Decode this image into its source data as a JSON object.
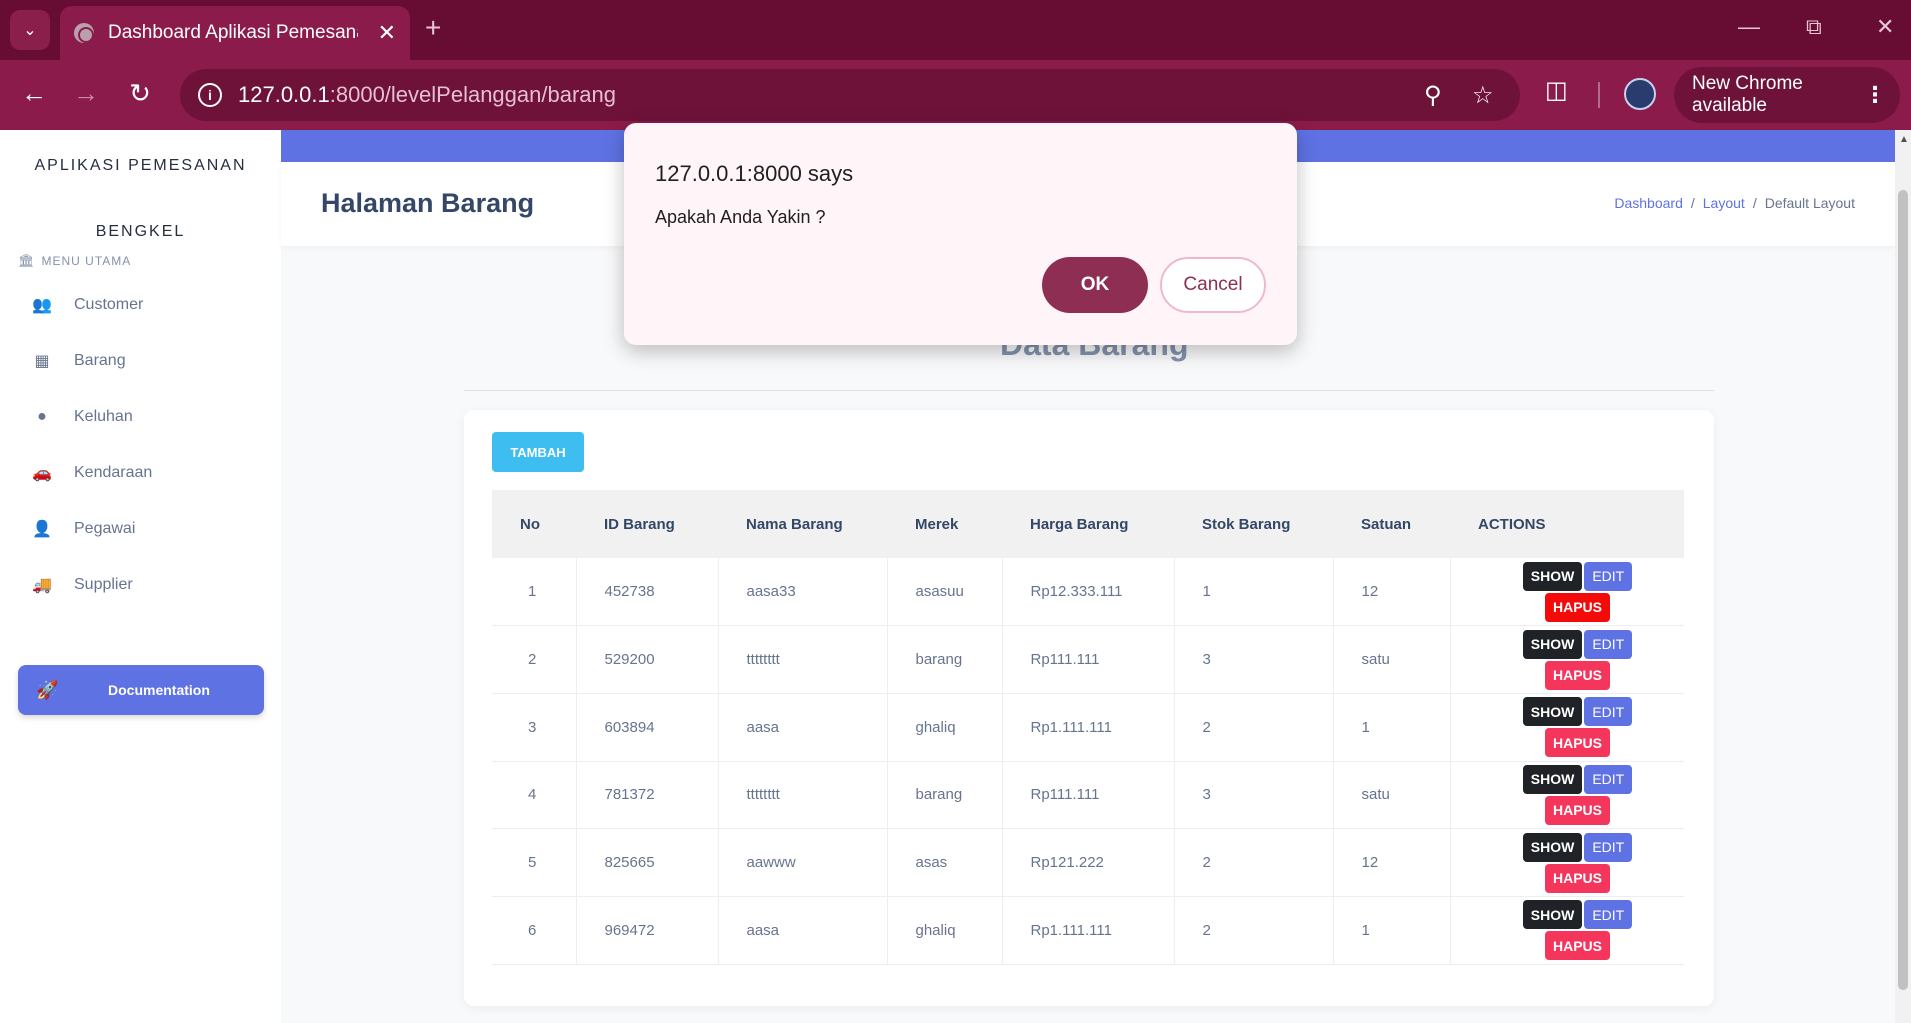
{
  "browser": {
    "tab_title": "Dashboard Aplikasi Pemesanan",
    "url_host": "127.0.0.1",
    "url_path": ":8000/levelPelanggan/barang",
    "new_chrome_label": "New Chrome available"
  },
  "sidebar": {
    "brand_line1": "APLIKASI PEMESANAN",
    "brand_line2": "BENGKEL",
    "menu_heading": "MENU UTAMA",
    "items": [
      {
        "label": "Customer",
        "icon": "users-icon"
      },
      {
        "label": "Barang",
        "icon": "box-icon"
      },
      {
        "label": "Keluhan",
        "icon": "alert-icon"
      },
      {
        "label": "Kendaraan",
        "icon": "car-icon"
      },
      {
        "label": "Pegawai",
        "icon": "user-icon"
      },
      {
        "label": "Supplier",
        "icon": "truck-icon"
      }
    ],
    "documentation_label": "Documentation"
  },
  "header": {
    "page_title": "Halaman Barang",
    "breadcrumb": [
      "Dashboard",
      "Layout",
      "Default Layout"
    ]
  },
  "main": {
    "section_title": "Data Barang",
    "add_button": "TAMBAH",
    "columns": [
      "No",
      "ID Barang",
      "Nama Barang",
      "Merek",
      "Harga Barang",
      "Stok Barang",
      "Satuan",
      "ACTIONS"
    ],
    "rows": [
      {
        "no": "1",
        "id": "452738",
        "nama": "aasa33",
        "merek": "asasuu",
        "harga": "Rp12.333.111",
        "stok": "1",
        "satuan": "12"
      },
      {
        "no": "2",
        "id": "529200",
        "nama": "tttttttt",
        "merek": "barang",
        "harga": "Rp111.111",
        "stok": "3",
        "satuan": "satu"
      },
      {
        "no": "3",
        "id": "603894",
        "nama": "aasa",
        "merek": "ghaliq",
        "harga": "Rp1.111.111",
        "stok": "2",
        "satuan": "1"
      },
      {
        "no": "4",
        "id": "781372",
        "nama": "tttttttt",
        "merek": "barang",
        "harga": "Rp111.111",
        "stok": "3",
        "satuan": "satu"
      },
      {
        "no": "5",
        "id": "825665",
        "nama": "aawww",
        "merek": "asas",
        "harga": "Rp121.222",
        "stok": "2",
        "satuan": "12"
      },
      {
        "no": "6",
        "id": "969472",
        "nama": "aasa",
        "merek": "ghaliq",
        "harga": "Rp1.111.111",
        "stok": "2",
        "satuan": "1"
      }
    ],
    "action_labels": {
      "show": "SHOW",
      "edit": "EDIT",
      "hapus": "HAPUS"
    }
  },
  "dialog": {
    "title": "127.0.0.1:8000 says",
    "message": "Apakah Anda Yakin ?",
    "ok_label": "OK",
    "cancel_label": "Cancel"
  },
  "colors": {
    "chrome": "#8b1b4b",
    "primary": "#5e72e4",
    "info": "#3dbdf0",
    "danger": "#f5365c",
    "dark": "#1f2226"
  }
}
